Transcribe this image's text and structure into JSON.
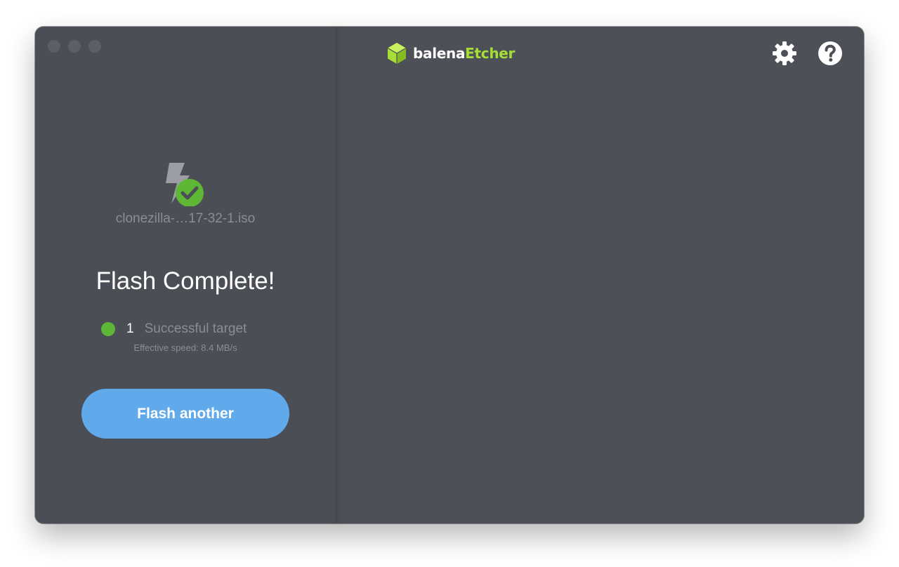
{
  "app": {
    "logo_text_primary": "balena",
    "logo_text_accent": "Etcher",
    "logo_icon": "balena-cube-icon",
    "accent_color": "#a5de37"
  },
  "window_controls": [
    "close",
    "minimize",
    "maximize"
  ],
  "header": {
    "settings_icon": "gear-icon",
    "help_icon": "question-circle-icon"
  },
  "flash_result": {
    "status_icon": "flash-complete-icon",
    "image_name": "clonezilla-…17-32-1.iso",
    "title": "Flash Complete!",
    "successful_count": "1",
    "successful_label": "Successful target",
    "status_color": "#5fb835",
    "effective_speed": "Effective speed: 8.4 MB/s",
    "action_label": "Flash another",
    "action_color": "#60aaeb"
  }
}
